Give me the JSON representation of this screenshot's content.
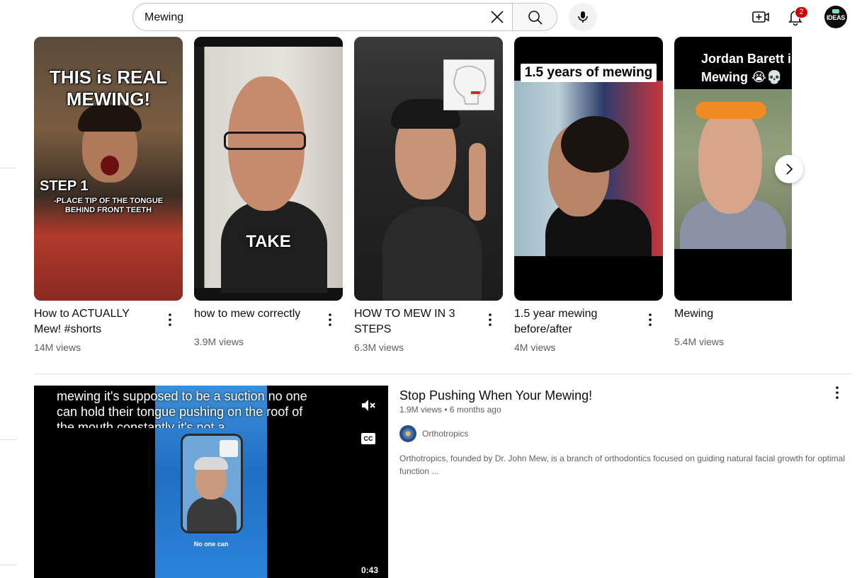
{
  "search": {
    "query": "Mewing"
  },
  "header": {
    "notification_count": "2",
    "avatar_text": "IDEAS"
  },
  "shorts": [
    {
      "overlay_lines": [
        "THIS is REAL",
        "MEWING!"
      ],
      "overlay_sub": [
        "STEP 1",
        "-PLACE TIP OF THE TONGUE",
        "BEHIND FRONT TEETH"
      ],
      "title": "How to ACTUALLY Mew! #shorts",
      "views": "14M views"
    },
    {
      "overlay_lines": [
        "TAKE"
      ],
      "title": "how to mew correctly",
      "views": "3.9M views"
    },
    {
      "overlay_lines": [],
      "title": "HOW TO MEW IN 3 STEPS",
      "views": "6.3M views"
    },
    {
      "overlay_lines": [
        "1.5 years of mewing"
      ],
      "title": "1.5 year mewing before/after",
      "views": "4M views"
    },
    {
      "overlay_lines": [
        "Jordan Barett is",
        "Mewing 😭💀"
      ],
      "title": "Mewing",
      "views": "5.4M views"
    }
  ],
  "video": {
    "title": "Stop Pushing When Your Mewing!",
    "views": "1.9M views",
    "age": "6 months ago",
    "channel": "Orthotropics",
    "description": "Orthotropics, founded by Dr. John Mew, is a branch of orthodontics focused on guiding natural facial growth for optimal function ...",
    "caption_text": "mewing it's supposed to be a suction no one can hold their tongue pushing on the roof of the mouth constantly it's not a",
    "inner_caption": "No one can",
    "duration": "0:43",
    "cc_label": "CC"
  },
  "colors": {
    "badge": "#cc0000",
    "meta_text": "#606060",
    "primary_text": "#0f0f0f"
  }
}
